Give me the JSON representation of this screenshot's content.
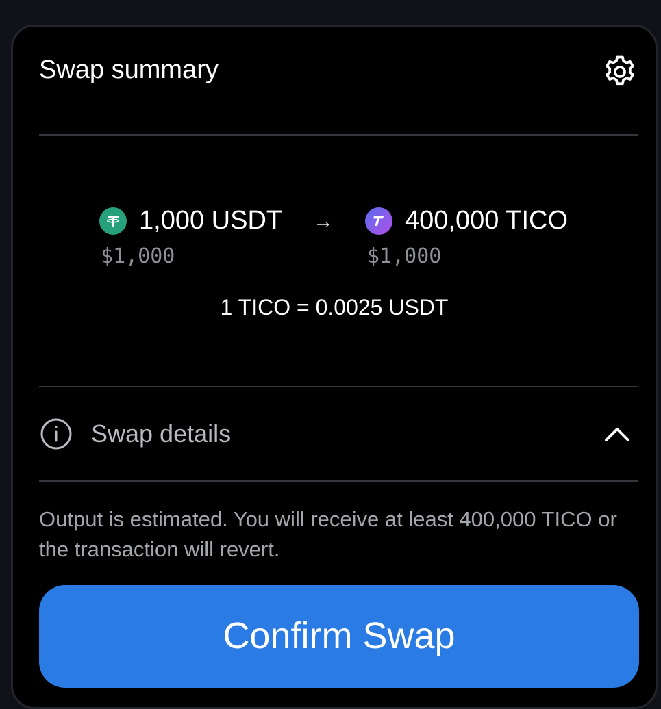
{
  "header": {
    "title": "Swap summary",
    "settings_icon": "gear-icon"
  },
  "swap": {
    "from": {
      "amount": "1,000 USDT",
      "usd_value": "$1,000",
      "icon": "tether-icon",
      "icon_color": "#26a17b"
    },
    "arrow": "→",
    "to": {
      "amount": "400,000 TICO",
      "usd_value": "$1,000",
      "icon": "tico-icon",
      "icon_colors": [
        "#5a6cf0",
        "#b04fe6"
      ]
    },
    "rate": "1 TICO = 0.0025 USDT"
  },
  "details": {
    "label": "Swap details",
    "info_icon": "info-icon",
    "toggle_icon": "chevron-up-icon"
  },
  "note": "Output is estimated. You will receive at least 400,000 TICO or the transaction will revert.",
  "actions": {
    "confirm_label": "Confirm Swap",
    "confirm_color": "#2a7be4"
  }
}
